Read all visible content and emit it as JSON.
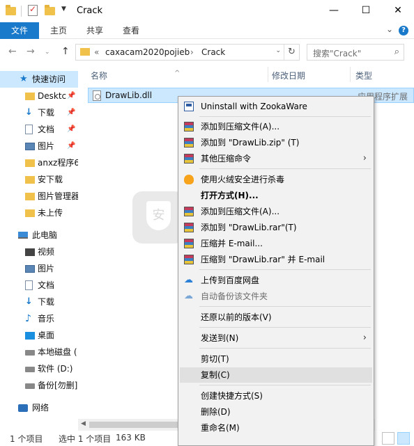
{
  "window": {
    "title": "Crack",
    "controls": {
      "minimize": "—",
      "maximize": "☐",
      "close": "✕"
    }
  },
  "ribbon": {
    "tabs": [
      "文件",
      "主页",
      "共享",
      "查看"
    ]
  },
  "address": {
    "prefix": "«",
    "crumbs": [
      "caxacam2020pojieb",
      "Crack"
    ],
    "separator": "›"
  },
  "search": {
    "placeholder": "搜索\"Crack\""
  },
  "sidebar": {
    "items": [
      {
        "label": "快速访问",
        "icon": "star-icon"
      },
      {
        "label": "Desktc",
        "icon": "folder-icon",
        "pinned": true
      },
      {
        "label": "下载",
        "icon": "download-icon",
        "pinned": true
      },
      {
        "label": "文档",
        "icon": "document-icon",
        "pinned": true
      },
      {
        "label": "图片",
        "icon": "picture-icon",
        "pinned": true
      },
      {
        "label": "anxz程序6",
        "icon": "folder-icon"
      },
      {
        "label": "安下载",
        "icon": "folder-icon"
      },
      {
        "label": "图片管理器",
        "icon": "folder-icon"
      },
      {
        "label": "未上传",
        "icon": "folder-icon"
      },
      {
        "label": "此电脑",
        "icon": "pc-icon"
      },
      {
        "label": "视频",
        "icon": "video-icon"
      },
      {
        "label": "图片",
        "icon": "picture-icon"
      },
      {
        "label": "文档",
        "icon": "document-icon"
      },
      {
        "label": "下载",
        "icon": "download-icon"
      },
      {
        "label": "音乐",
        "icon": "music-icon"
      },
      {
        "label": "桌面",
        "icon": "desktop-icon"
      },
      {
        "label": "本地磁盘 (",
        "icon": "disk-icon"
      },
      {
        "label": "软件 (D:)",
        "icon": "disk-icon"
      },
      {
        "label": "备份[勿删]",
        "icon": "disk-icon"
      },
      {
        "label": "网络",
        "icon": "network-icon"
      }
    ]
  },
  "columns": {
    "name": "名称",
    "modified": "修改日期",
    "type": "类型"
  },
  "file": {
    "name": "DrawLib.dll",
    "type": "应用程序扩展"
  },
  "context_menu": {
    "items": [
      {
        "label": "Uninstall with ZookaWare",
        "icon": "zookaware-icon"
      },
      {
        "label": "添加到压缩文件(A)...",
        "icon": "winrar-icon"
      },
      {
        "label": "添加到 \"DrawLib.zip\" (T)",
        "icon": "winrar-icon"
      },
      {
        "label": "其他压缩命令",
        "icon": "winrar-icon",
        "submenu": true
      },
      {
        "label": "使用火绒安全进行杀毒",
        "icon": "huorong-icon"
      },
      {
        "label": "打开方式(H)...",
        "bold": true
      },
      {
        "label": "添加到压缩文件(A)...",
        "icon": "winrar-icon"
      },
      {
        "label": "添加到 \"DrawLib.rar\"(T)",
        "icon": "winrar-icon"
      },
      {
        "label": "压缩并 E-mail...",
        "icon": "winrar-icon"
      },
      {
        "label": "压缩到 \"DrawLib.rar\" 并 E-mail",
        "icon": "winrar-icon"
      },
      {
        "label": "上传到百度网盘",
        "icon": "baidu-cloud-icon"
      },
      {
        "label": "自动备份该文件夹",
        "icon": "baidu-cloud-icon",
        "disabled": true
      },
      {
        "label": "还原以前的版本(V)"
      },
      {
        "label": "发送到(N)",
        "submenu": true
      },
      {
        "label": "剪切(T)"
      },
      {
        "label": "复制(C)",
        "highlighted": true
      },
      {
        "label": "创建快捷方式(S)"
      },
      {
        "label": "删除(D)"
      },
      {
        "label": "重命名(M)"
      }
    ]
  },
  "status": {
    "count": "1 个项目",
    "selected": "选中 1 个项目",
    "size": "163 KB"
  },
  "colors": {
    "accent": "#1979ca",
    "selection": "#cce8ff",
    "menu_bg": "#f2f2f2"
  }
}
